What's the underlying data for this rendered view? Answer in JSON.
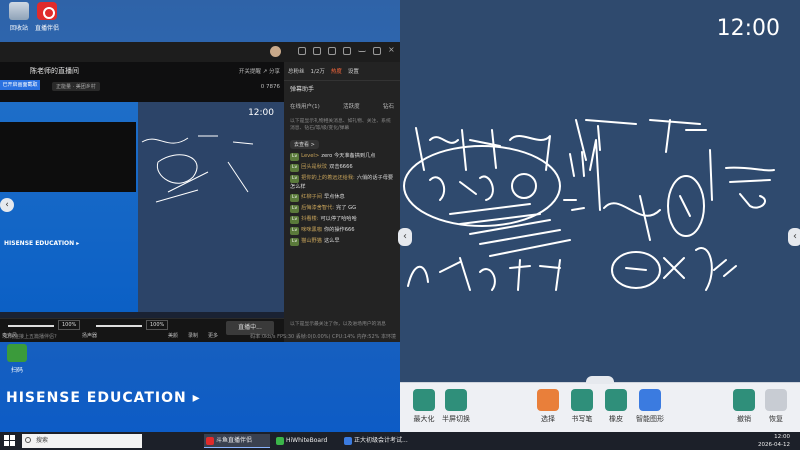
{
  "desktop": {
    "icons": [
      "回收站",
      "直播伴侣",
      "扫码"
    ],
    "brand": "HISENSE EDUCATION"
  },
  "live_app": {
    "room_title": "陈老师的直播间",
    "room_sub": "正能量 · 美团乡村",
    "preview_btn": "已开启画面截取",
    "top_actions": "开关提醒   ↗ 分享",
    "stats": "0   7876",
    "preview_time": "12:00",
    "preview_brand": "HISENSE EDUCATION ▸",
    "mic_label": "麦克风",
    "mic_pct": "100%",
    "spk_label": "扬声器",
    "spk_pct": "100%",
    "effects": [
      "美颜",
      "录制",
      "更多"
    ],
    "status": "直播中...",
    "bottom_info": "如何连接上五篇播伴侣?",
    "bottom_stats": "码率:0kb/s   FPS:30   丢帧:0(0.00%)   CPU:14%   内存:52%   本环境"
  },
  "chat": {
    "header": [
      "总粉丝",
      "1/2万",
      "热度",
      "设置"
    ],
    "danmu_title": "弹幕助手",
    "tabs": [
      "在线用户(1)",
      "活跃度",
      "钻石"
    ],
    "notice": "以下是显示礼物相关消息、如礼物、关注、系统消息、钻石/等/级/变化/弹幕",
    "viewer": "去查看 >",
    "messages": [
      {
        "lv": "Lv",
        "name": "Level>",
        "text": "zero  今天准备搞到几点"
      },
      {
        "lv": "Lv",
        "name": "回头是秋玟",
        "text": "双击6666"
      },
      {
        "lv": "Lv",
        "name": "把你的上的着远还给我:",
        "text": "六俏的话子母要怎么样"
      },
      {
        "lv": "Lv",
        "name": "红柳子间",
        "text": "早点休息"
      },
      {
        "lv": "Lv",
        "name": "后悔漆舍智代:",
        "text": "完了 GG"
      },
      {
        "lv": "Lv",
        "name": "抖看楼:",
        "text": "可以停了哈哈哈"
      },
      {
        "lv": "Lv",
        "name": "咪咪黑咖",
        "text": "你的操作666"
      },
      {
        "lv": "Lv",
        "name": "猫山野猫",
        "text": "这么早"
      }
    ],
    "footer": "以下是显示最关注了你，以及进场用户的消息"
  },
  "board": {
    "time": "12:00",
    "tools": [
      {
        "label": "最大化",
        "icon": "maximize-icon"
      },
      {
        "label": "半屏切换",
        "icon": "swap-icon"
      },
      {
        "label": "选择",
        "icon": "select-cursor-icon"
      },
      {
        "label": "书写笔",
        "icon": "pen-icon"
      },
      {
        "label": "橡皮",
        "icon": "eraser-icon"
      },
      {
        "label": "智能图形",
        "icon": "shapes-icon"
      },
      {
        "label": "撤销",
        "icon": "undo-icon"
      },
      {
        "label": "恢复",
        "icon": "redo-icon"
      }
    ]
  },
  "taskbar": {
    "search": "搜索",
    "tasks": [
      "斗鱼直播伴侣",
      "HiWhiteBoard",
      "正大初级会计考试..."
    ],
    "time": "12:00",
    "date": "2026-04-12"
  }
}
